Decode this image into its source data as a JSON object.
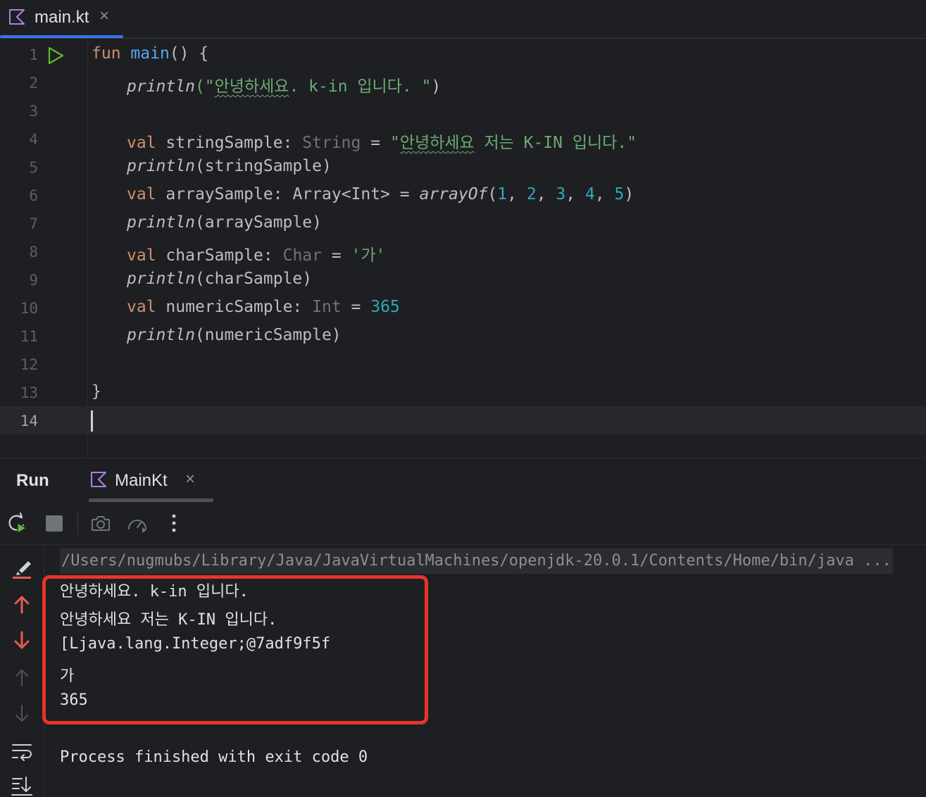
{
  "editor_tab": {
    "filename": "main.kt",
    "close": "×"
  },
  "code_lines": [
    {
      "n": "1"
    },
    {
      "n": "2"
    },
    {
      "n": "3"
    },
    {
      "n": "4"
    },
    {
      "n": "5"
    },
    {
      "n": "6"
    },
    {
      "n": "7"
    },
    {
      "n": "8"
    },
    {
      "n": "9"
    },
    {
      "n": "10"
    },
    {
      "n": "11"
    },
    {
      "n": "12"
    },
    {
      "n": "13"
    },
    {
      "n": "14"
    }
  ],
  "code": {
    "l1": {
      "kw": "fun",
      "name": "main",
      "rest": "() {"
    },
    "l2": {
      "call": "println",
      "open": "(\"",
      "korean": "안녕하세요",
      "rest": ". k-in 입니다. \"",
      "close": ")"
    },
    "l4": {
      "kw": "val",
      "var": "stringSample",
      "colon": ":",
      "type": "String",
      "eq": " = ",
      "q": "\"",
      "korean": "안녕하세요",
      "rest": " 저는 K-IN 입니다.\""
    },
    "l5": {
      "call": "println",
      "args": "(stringSample)"
    },
    "l6": {
      "kw": "val",
      "var": "arraySample",
      "colon": ":",
      "type": "Array<Int>",
      "eq": " = ",
      "call": "arrayOf",
      "open": "(",
      "n1": "1",
      "n2": "2",
      "n3": "3",
      "n4": "4",
      "n5": "5",
      "comma": ", ",
      "close": ")"
    },
    "l7": {
      "call": "println",
      "args": "(arraySample)"
    },
    "l8": {
      "kw": "val",
      "var": "charSample",
      "colon": ":",
      "type": "Char",
      "eq": " = ",
      "str": "'가'"
    },
    "l9": {
      "call": "println",
      "args": "(charSample)"
    },
    "l10": {
      "kw": "val",
      "var": "numericSample",
      "colon": ":",
      "type": "Int",
      "eq": " = ",
      "num": "365"
    },
    "l11": {
      "call": "println",
      "args": "(numericSample)"
    },
    "l13": {
      "brace": "}"
    }
  },
  "run_panel": {
    "title": "Run",
    "tab_label": "MainKt",
    "tab_close": "×",
    "command": "/Users/nugmubs/Library/Java/JavaVirtualMachines/openjdk-20.0.1/Contents/Home/bin/java ...",
    "output": [
      "안녕하세요. k-in 입니다.",
      "안녕하세요 저는 K-IN 입니다.",
      "[Ljava.lang.Integer;@7adf9f5f",
      "가",
      "365"
    ],
    "exit_message": "Process finished with exit code 0"
  },
  "toolbar_icons": [
    "rerun-icon",
    "stop-icon",
    "camera-icon",
    "profiler-icon",
    "more-icon"
  ],
  "strip_icons": [
    "clear-icon",
    "arrow-up-icon",
    "arrow-down-icon",
    "scroll-up-icon",
    "scroll-down-icon",
    "soft-wrap-icon",
    "scroll-to-end-icon"
  ],
  "colors": {
    "accent": "#3574f0",
    "highlight": "#e8332b",
    "keyword": "#cf8e6d",
    "function": "#56a8f5",
    "string": "#6aab73",
    "number": "#2aacb8",
    "run_green": "#5fb832"
  }
}
